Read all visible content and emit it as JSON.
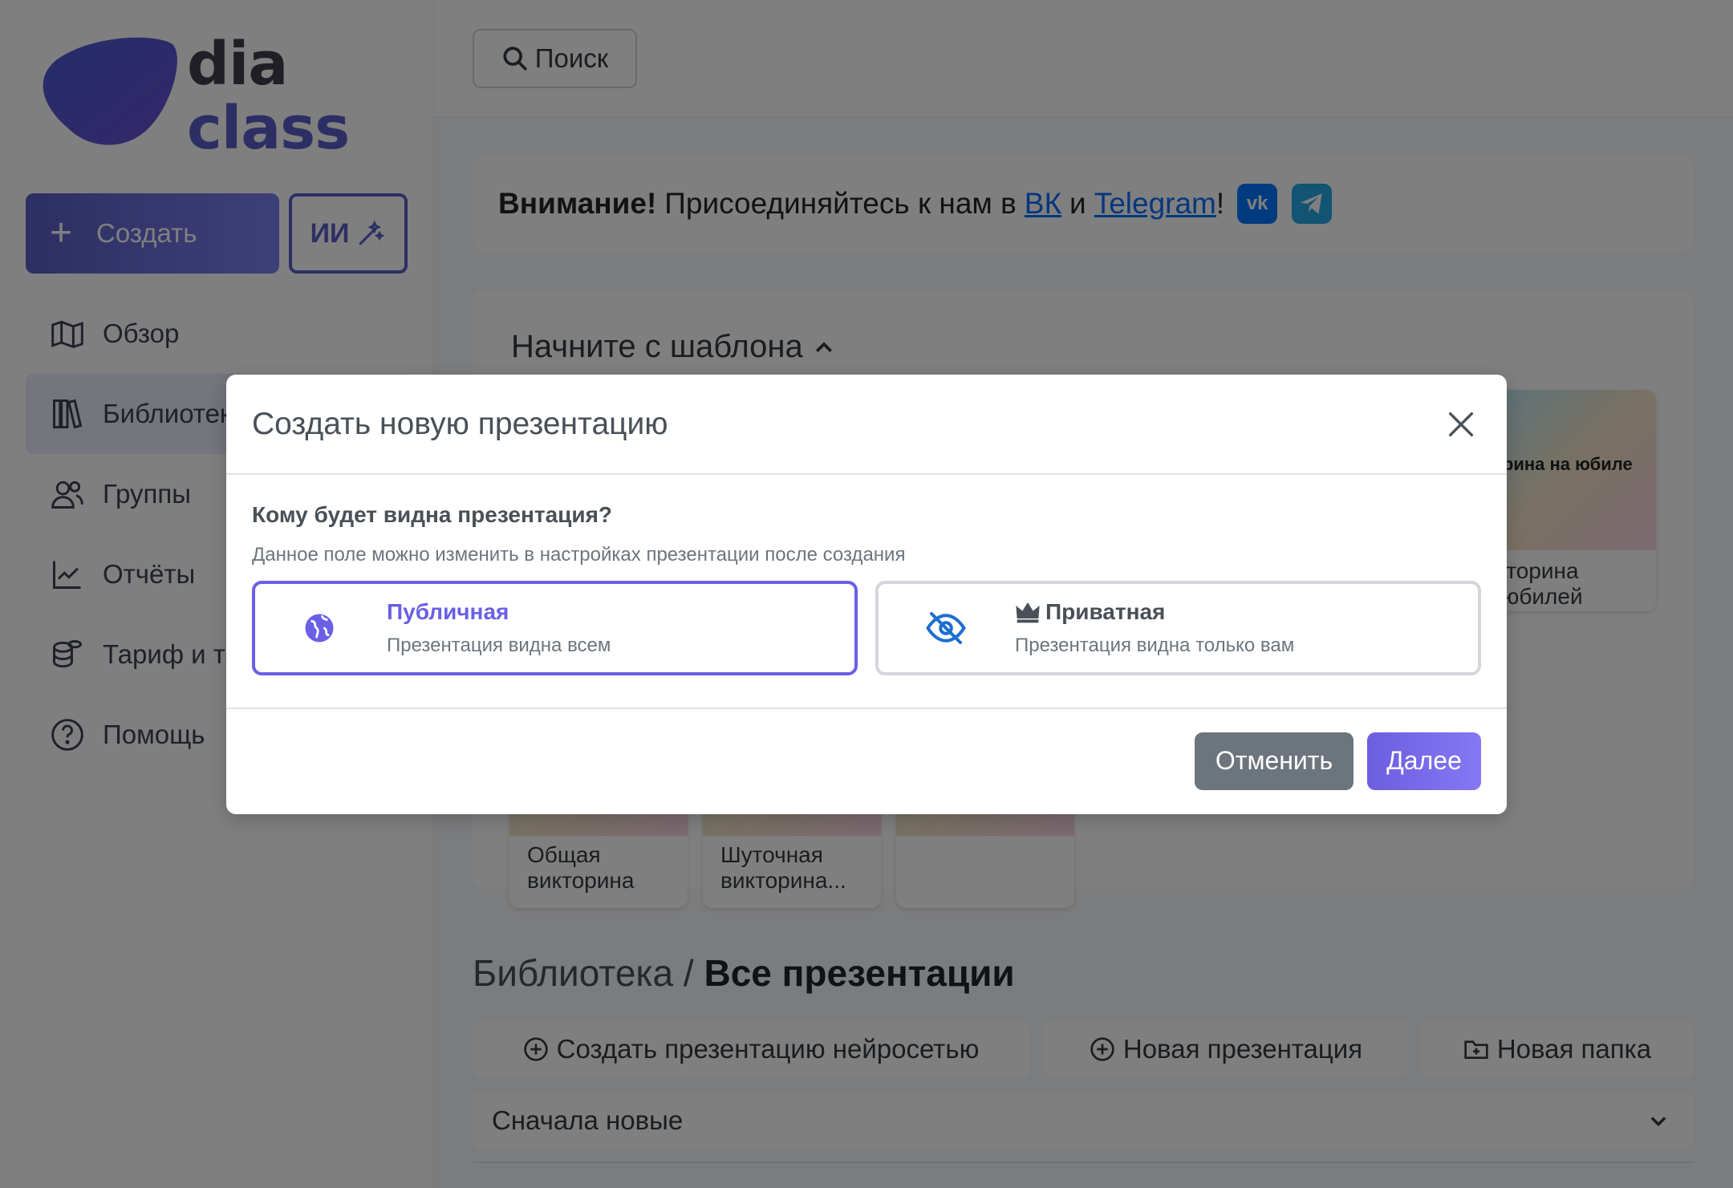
{
  "app": {
    "logo_line1": "dia",
    "logo_line2": "class",
    "brand_color": "#5b5ec8"
  },
  "sidebar": {
    "create_label": "Создать",
    "ai_label": "ИИ",
    "items": [
      {
        "label": "Обзор",
        "icon": "map-icon"
      },
      {
        "label": "Библиотека",
        "icon": "books-icon",
        "active": true
      },
      {
        "label": "Группы",
        "icon": "users-icon"
      },
      {
        "label": "Отчёты",
        "icon": "chart-icon"
      },
      {
        "label": "Тариф и то",
        "icon": "coins-icon"
      },
      {
        "label": "Помощь",
        "icon": "question-icon"
      }
    ]
  },
  "topbar": {
    "search_label": "Поиск"
  },
  "notice": {
    "bold": "Внимание!",
    "text": "Присоединяйтесь к нам в",
    "link_vk": "ВК",
    "conj": "и",
    "link_tg": "Telegram",
    "excl": "!"
  },
  "templates": {
    "title": "Начните с шаблона",
    "cards": [
      {
        "name_line1": "Общая",
        "name_line2": "викторина"
      },
      {
        "name_line1": "Шуточная",
        "name_line2": "викторина..."
      },
      {
        "name_line1": "",
        "name_line2": ""
      },
      {
        "thumb_caption": "торина на юбиле",
        "name_line1": "икторина",
        "name_line2": "а юбилей"
      }
    ]
  },
  "library": {
    "crumb": "Библиотека / ",
    "section": "Все презентации",
    "btn_ai": "Создать презентацию нейросетью",
    "btn_new": "Новая презентация",
    "btn_folder": "Новая папка",
    "sort_label": "Сначала новые"
  },
  "modal": {
    "title": "Создать новую презентацию",
    "question": "Кому будет видна презентация?",
    "hint": "Данное поле можно изменить в настройках презентации после создания",
    "public_title": "Публичная",
    "public_desc": "Презентация видна всем",
    "private_title": "Приватная",
    "private_desc": "Презентация видна только вам",
    "cancel_label": "Отменить",
    "next_label": "Далее"
  }
}
